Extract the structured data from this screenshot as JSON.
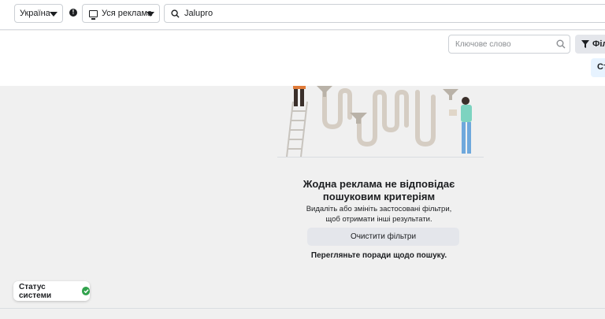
{
  "topbar": {
    "country_value": "Україна",
    "ad_type_value": "Уся реклама",
    "search_value": "Jalupro"
  },
  "subbar": {
    "keyword_placeholder": "Ключове слово",
    "filters_label": "Філ",
    "sort_label": "Ст"
  },
  "empty_state": {
    "title": "Жодна реклама не відповідає пошуковим критеріям",
    "description": "Видаліть або змініть застосовані фільтри, щоб отримати інші результати.",
    "clear_button": "Очистити фільтри",
    "tips_link": "Перегляньте поради щодо пошуку."
  },
  "system_status": {
    "label": "Статус системи"
  },
  "colors": {
    "status_ok": "#31a24c",
    "illustration_person": "#6fa8dc"
  }
}
